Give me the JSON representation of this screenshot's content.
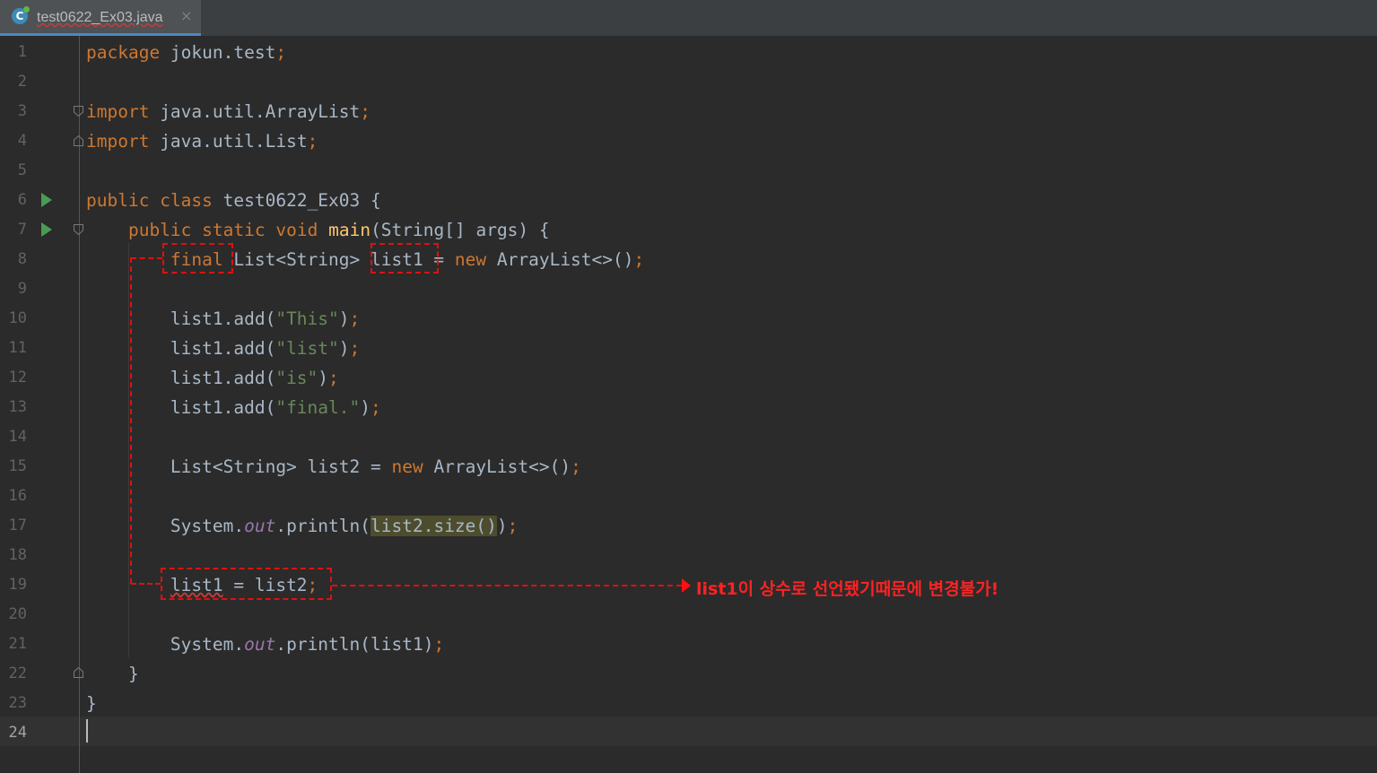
{
  "tab": {
    "filename": "test0622_Ex03.java",
    "icon": "java-class-icon",
    "close": "×"
  },
  "lines": [
    {
      "n": "1",
      "t": "package jokun.test;"
    },
    {
      "n": "2",
      "t": ""
    },
    {
      "n": "3",
      "t": "import java.util.ArrayList;"
    },
    {
      "n": "4",
      "t": "import java.util.List;"
    },
    {
      "n": "5",
      "t": ""
    },
    {
      "n": "6",
      "t": "public class test0622_Ex03 {"
    },
    {
      "n": "7",
      "t": "    public static void main(String[] args) {"
    },
    {
      "n": "8",
      "t": "        final List<String> list1 = new ArrayList<>();"
    },
    {
      "n": "9",
      "t": ""
    },
    {
      "n": "10",
      "t": "        list1.add(\"This\");"
    },
    {
      "n": "11",
      "t": "        list1.add(\"list\");"
    },
    {
      "n": "12",
      "t": "        list1.add(\"is\");"
    },
    {
      "n": "13",
      "t": "        list1.add(\"final.\");"
    },
    {
      "n": "14",
      "t": ""
    },
    {
      "n": "15",
      "t": "        List<String> list2 = new ArrayList<>();"
    },
    {
      "n": "16",
      "t": ""
    },
    {
      "n": "17",
      "t": "        System.out.println(list2.size());"
    },
    {
      "n": "18",
      "t": ""
    },
    {
      "n": "19",
      "t": "        list1 = list2;"
    },
    {
      "n": "20",
      "t": ""
    },
    {
      "n": "21",
      "t": "        System.out.println(list1);"
    },
    {
      "n": "22",
      "t": "    }"
    },
    {
      "n": "23",
      "t": "}"
    },
    {
      "n": "24",
      "t": ""
    }
  ],
  "current_line": "24",
  "annotation": {
    "text": "list1이 상수로 선언됐기때문에 변경불가!",
    "color": "#ff2222"
  },
  "colors": {
    "background": "#2b2b2b",
    "keyword": "#cc7832",
    "string": "#6a8759",
    "method": "#ffc66d",
    "static_field": "#9876aa",
    "plain": "#a9b7c6",
    "annotation_box": "#e01010"
  }
}
